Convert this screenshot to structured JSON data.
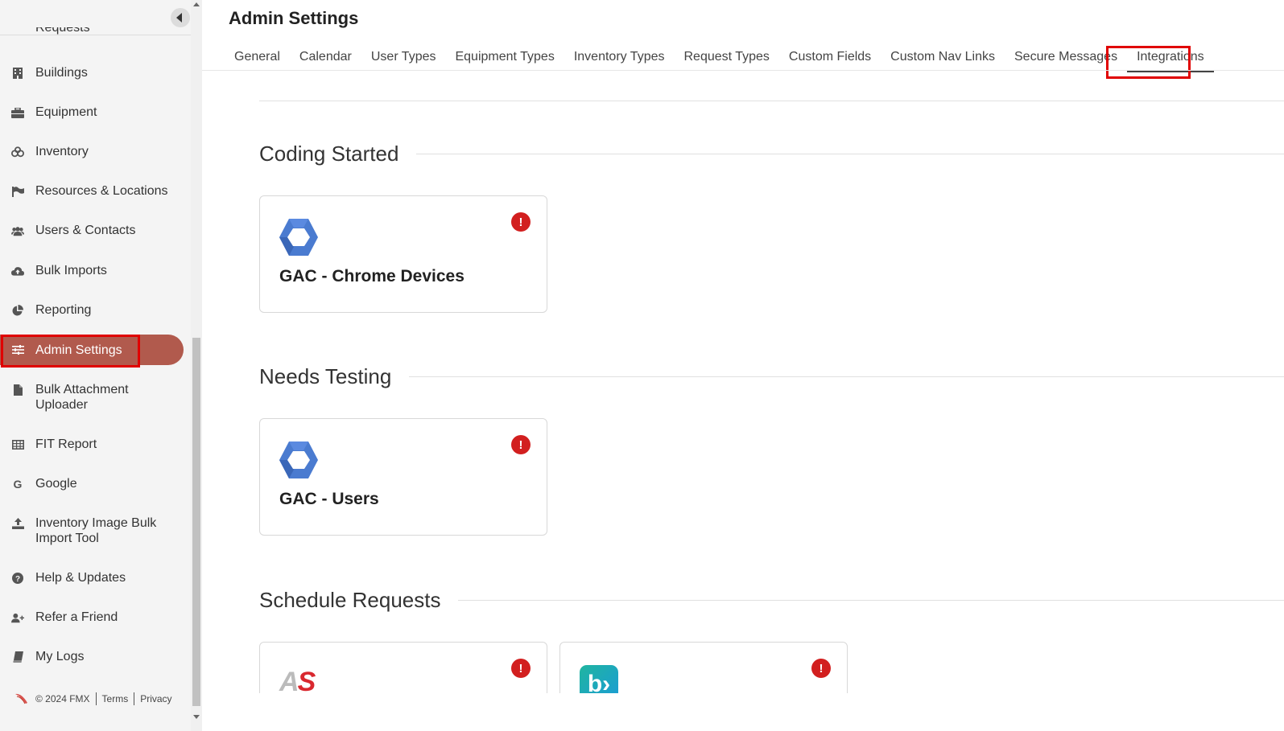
{
  "sidebar": {
    "partial_item": "Requests",
    "items": [
      {
        "label": "Buildings",
        "icon": "building-icon"
      },
      {
        "label": "Equipment",
        "icon": "toolbox-icon"
      },
      {
        "label": "Inventory",
        "icon": "boxes-icon"
      },
      {
        "label": "Resources & Locations",
        "icon": "flag-icon"
      },
      {
        "label": "Users & Contacts",
        "icon": "users-icon"
      },
      {
        "label": "Bulk Imports",
        "icon": "cloud-upload-icon"
      },
      {
        "label": "Reporting",
        "icon": "pie-chart-icon"
      },
      {
        "label": "Admin Settings",
        "icon": "sliders-icon",
        "active": true
      },
      {
        "label": "Bulk Attachment Uploader",
        "icon": "file-icon"
      },
      {
        "label": "FIT Report",
        "icon": "table-icon"
      },
      {
        "label": "Google",
        "icon": "google-icon"
      },
      {
        "label": "Inventory Image Bulk Import Tool",
        "icon": "upload-icon"
      },
      {
        "label": "Help & Updates",
        "icon": "question-circle-icon"
      },
      {
        "label": "Refer a Friend",
        "icon": "user-plus-icon"
      },
      {
        "label": "My Logs",
        "icon": "book-icon"
      }
    ],
    "footer": {
      "copyright": "© 2024 FMX",
      "terms": "Terms",
      "privacy": "Privacy"
    }
  },
  "header": {
    "title": "Admin Settings",
    "tabs": [
      "General",
      "Calendar",
      "User Types",
      "Equipment Types",
      "Inventory Types",
      "Request Types",
      "Custom Fields",
      "Custom Nav Links",
      "Secure Messages",
      "Integrations"
    ],
    "active_tab": "Integrations"
  },
  "sections": [
    {
      "title": "Coding Started",
      "cards": [
        {
          "title": "GAC - Chrome Devices",
          "logo": "google-chrome-enterprise-logo"
        }
      ]
    },
    {
      "title": "Needs Testing",
      "cards": [
        {
          "title": "GAC - Users",
          "logo": "google-chrome-enterprise-logo"
        }
      ]
    },
    {
      "title": "Schedule Requests",
      "cards": [
        {
          "title": "",
          "logo": "as-logo",
          "logo_text": "AS"
        },
        {
          "title": "",
          "logo": "b-logo",
          "logo_text": "b›"
        }
      ]
    }
  ],
  "alert_symbol": "!",
  "colors": {
    "accent": "#b15a4d",
    "alert": "#d21f1f",
    "highlight": "#e00000",
    "chrome_blue": "#4a7bd0"
  }
}
